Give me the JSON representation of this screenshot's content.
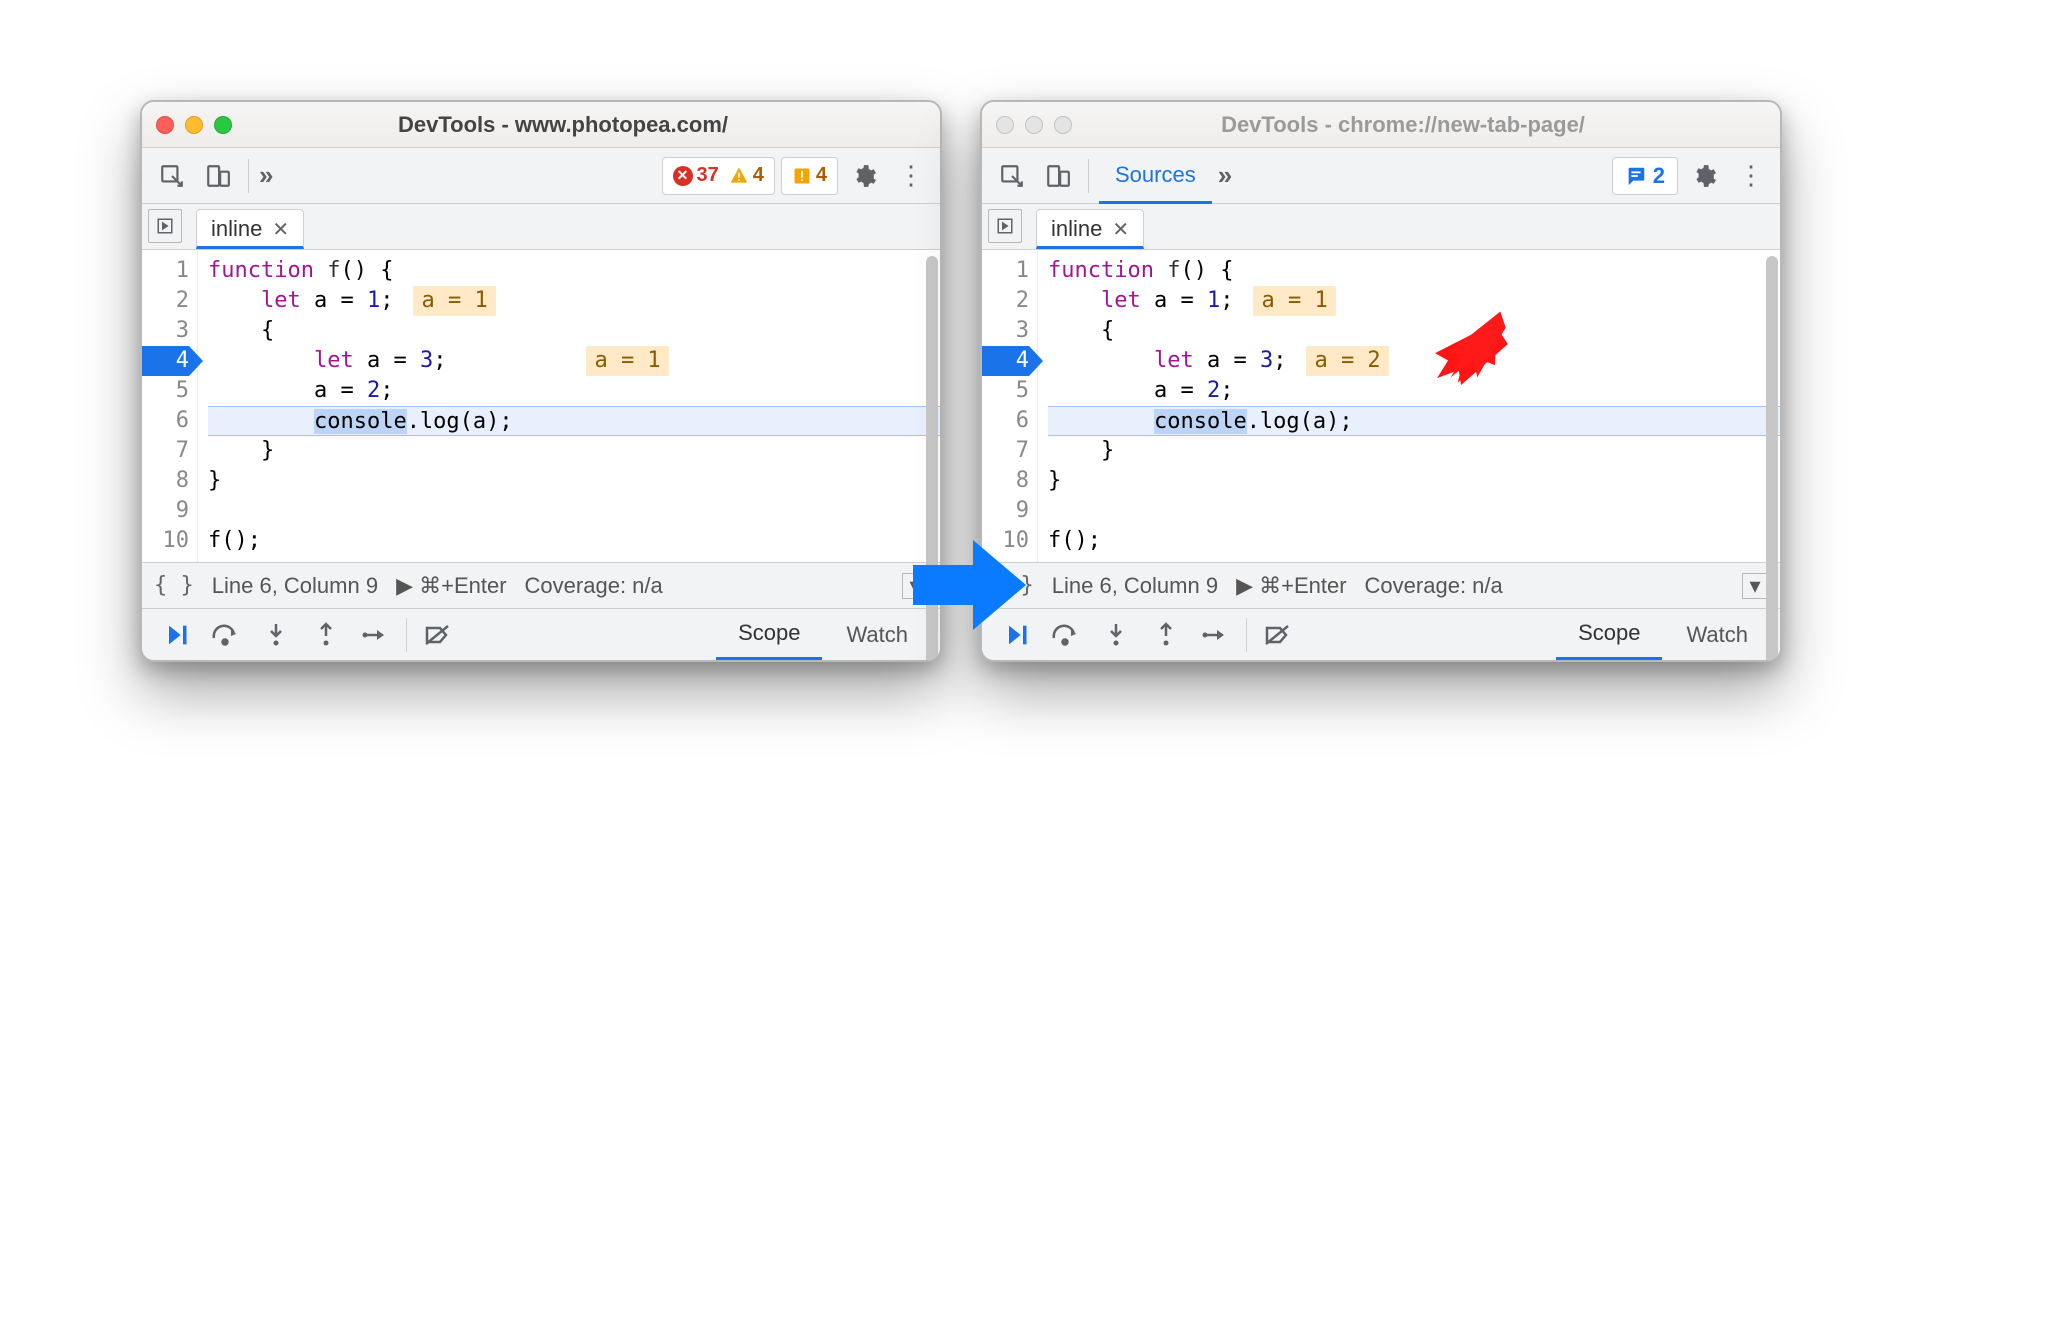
{
  "left": {
    "title": "DevTools - www.photopea.com/",
    "active": true,
    "toolbar": {
      "errors": "37",
      "warnings": "4",
      "issues": "4"
    },
    "file_tab": "inline",
    "lines": [
      "1",
      "2",
      "3",
      "4",
      "5",
      "6",
      "7",
      "8",
      "9",
      "10"
    ],
    "exec_line_index": 3,
    "highlight_line_index": 5,
    "code": {
      "l1": "function f() {",
      "l2_kw": "let",
      "l2_rest": " a = ",
      "l2_num": "1",
      "l2_tail": ";",
      "l2_hint": "a = 1",
      "l3": "    {",
      "l4_kw": "let",
      "l4_rest": " a = ",
      "l4_num": "3",
      "l4_tail": ";",
      "l4_hint": "a = 1",
      "l5": "        a = ",
      "l5_num": "2",
      "l5_tail": ";",
      "l6_sel": "console",
      "l6_rest": ".log(a);",
      "l7": "    }",
      "l8": "}",
      "l9": "",
      "l10": "f();"
    },
    "status": {
      "pos": "Line 6, Column 9",
      "shortcut": "⌘+Enter",
      "coverage": "Coverage: n/a"
    },
    "dbg_tabs": {
      "scope": "Scope",
      "watch": "Watch"
    }
  },
  "right": {
    "title": "DevTools - chrome://new-tab-page/",
    "active": false,
    "toolbar": {
      "sources_tab": "Sources",
      "msg_count": "2"
    },
    "file_tab": "inline",
    "lines": [
      "1",
      "2",
      "3",
      "4",
      "5",
      "6",
      "7",
      "8",
      "9",
      "10"
    ],
    "exec_line_index": 3,
    "highlight_line_index": 5,
    "code": {
      "l1": "function f() {",
      "l2_kw": "let",
      "l2_rest": " a = ",
      "l2_num": "1",
      "l2_tail": ";",
      "l2_hint": "a = 1",
      "l3": "    {",
      "l4_kw": "let",
      "l4_rest": " a = ",
      "l4_num": "3",
      "l4_tail": ";",
      "l4_hint": "a = 2",
      "l5": "        a = ",
      "l5_num": "2",
      "l5_tail": ";",
      "l6_sel": "console",
      "l6_rest": ".log(a);",
      "l7": "    }",
      "l8": "}",
      "l9": "",
      "l10": "f();"
    },
    "status": {
      "pos": "Line 6, Column 9",
      "shortcut": "⌘+Enter",
      "coverage": "Coverage: n/a"
    },
    "dbg_tabs": {
      "scope": "Scope",
      "watch": "Watch"
    }
  }
}
